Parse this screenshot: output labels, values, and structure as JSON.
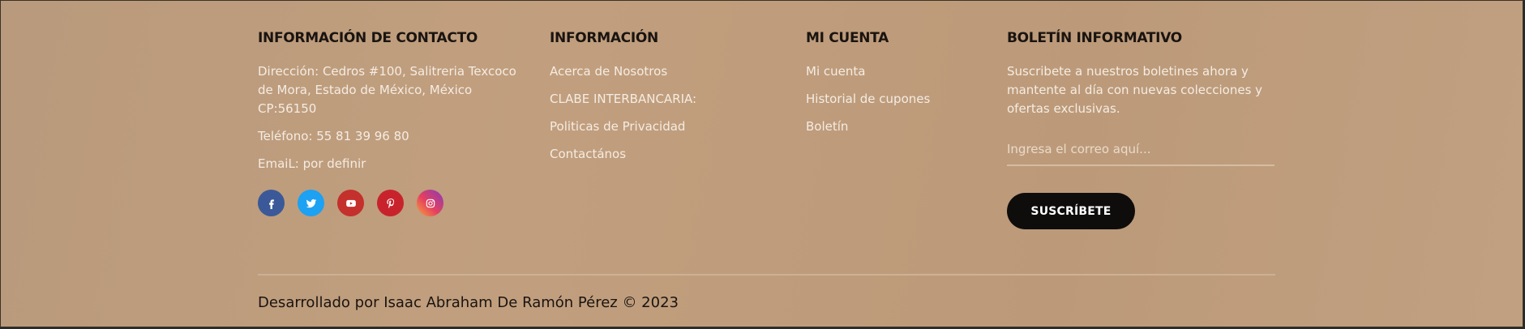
{
  "contact": {
    "heading": "INFORMACIÓN DE CONTACTO",
    "address": "Dirección: Cedros #100, Salitreria Texcoco de Mora, Estado de México, México CP:56150",
    "phone": "Teléfono: 55 81 39 96 80",
    "email": "EmaiL: por definir",
    "social": [
      {
        "name": "facebook-icon",
        "color": "#3b5998"
      },
      {
        "name": "twitter-icon",
        "color": "#1da1f2"
      },
      {
        "name": "youtube-icon",
        "color": "#c4302b"
      },
      {
        "name": "pinterest-icon",
        "color": "#c8232c"
      },
      {
        "name": "instagram-icon",
        "color": "#c13584"
      }
    ]
  },
  "info": {
    "heading": "INFORMACIÓN",
    "links": [
      "Acerca de Nosotros",
      "CLABE INTERBANCARIA:",
      "Politicas de Privacidad",
      "Contactános"
    ]
  },
  "account": {
    "heading": "MI CUENTA",
    "links": [
      "Mi cuenta",
      "Historial de cupones",
      "Boletín"
    ]
  },
  "newsletter": {
    "heading": "BOLETÍN INFORMATIVO",
    "description": "Suscribete a nuestros boletines ahora y mantente al día con nuevas colecciones y ofertas exclusivas.",
    "email_placeholder": "Ingresa el correo aquí...",
    "email_value": "",
    "button_label": "SUSCRÍBETE"
  },
  "copyright": "Desarrollado por Isaac Abraham De Ramón Pérez © 2023"
}
